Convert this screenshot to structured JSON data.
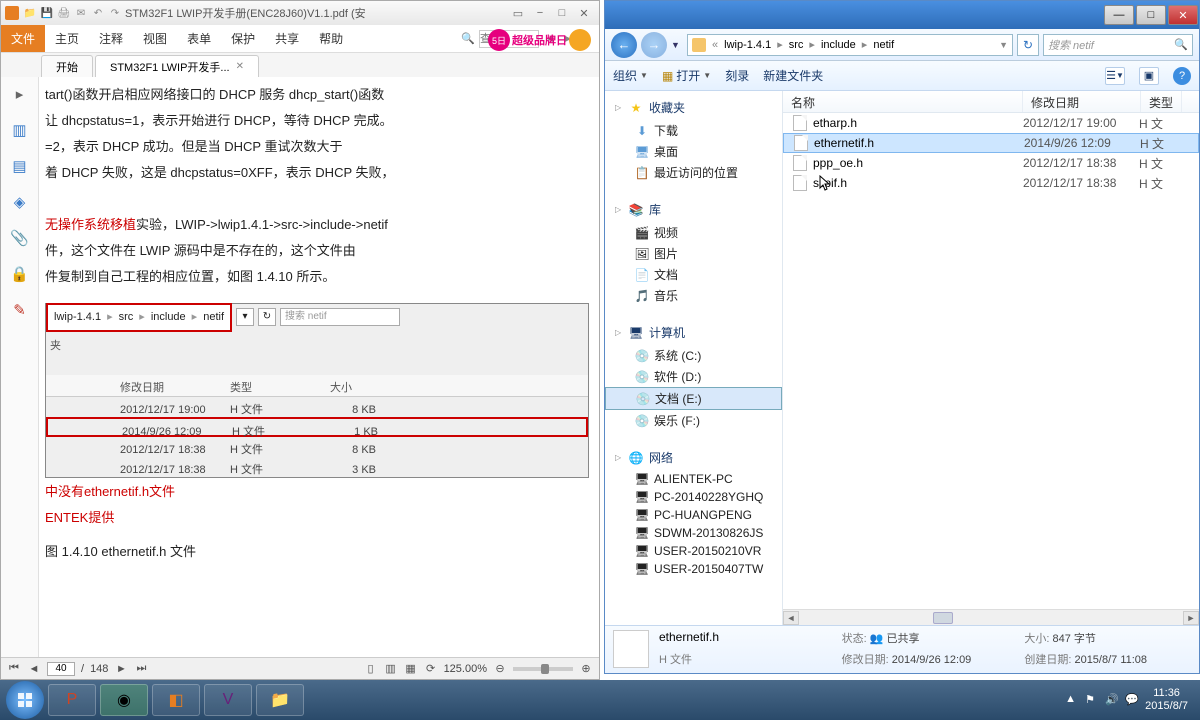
{
  "pdf": {
    "title": "STM32F1 LWIP开发手册(ENC28J60)V1.1.pdf (安",
    "menu": [
      "文件",
      "主页",
      "注释",
      "视图",
      "表单",
      "保护",
      "共享",
      "帮助"
    ],
    "search_placeholder": "查找",
    "promo": "超级品牌日",
    "promo_num": "5日",
    "tabs": [
      {
        "label": "开始"
      },
      {
        "label": "STM32F1 LWIP开发手..."
      }
    ],
    "body": {
      "p1": "tart()函数开启相应网络接口的 DHCP 服务 dhcp_start()函数",
      "p2": "让 dhcpstatus=1，表示开始进行 DHCP，等待 DHCP 完成。",
      "p3": "=2，表示 DHCP 成功。但是当 DHCP 重试次数大于",
      "p4": "着 DHCP 失败，这是 dhcpstatus=0XFF，表示 DHCP 失败，",
      "p5a": "无操作系统移植",
      "p5b": "实验，LWIP->lwip1.4.1->src->include->netif",
      "p6": "件，这个文件在 LWIP 源码中是不存在的，这个文件由",
      "p7": "件复制到自己工程的相应位置，如图 1.4.10 所示。",
      "crumb": [
        "lwip-1.4.1",
        "src",
        "include",
        "netif"
      ],
      "search2": "搜索 netif",
      "folder_label": "夹",
      "cols": [
        "修改日期",
        "类型",
        "大小"
      ],
      "rows": [
        {
          "d": "2012/12/17 19:00",
          "t": "H 文件",
          "s": "8 KB"
        },
        {
          "d": "2014/9/26 12:09",
          "t": "H 文件",
          "s": "1 KB"
        },
        {
          "d": "2012/12/17 18:38",
          "t": "H 文件",
          "s": "8 KB"
        },
        {
          "d": "2012/12/17 18:38",
          "t": "H 文件",
          "s": "3 KB"
        }
      ],
      "note1": "中没有ethernetif.h文件",
      "note2": "ENTEK提供",
      "caption": "图 1.4.10 ethernetif.h 文件"
    },
    "status": {
      "page": "40",
      "total": "148",
      "zoom": "125.00%"
    }
  },
  "explorer": {
    "crumbs": [
      "lwip-1.4.1",
      "src",
      "include",
      "netif"
    ],
    "search_placeholder": "搜索 netif",
    "toolbar": {
      "org": "组织",
      "open": "打开",
      "burn": "刻录",
      "newf": "新建文件夹"
    },
    "tree": {
      "fav": "收藏夹",
      "fav_items": [
        "下载",
        "桌面",
        "最近访问的位置"
      ],
      "lib": "库",
      "lib_items": [
        "视频",
        "图片",
        "文档",
        "音乐"
      ],
      "comp": "计算机",
      "comp_items": [
        "系统 (C:)",
        "软件 (D:)",
        "文档 (E:)",
        "娱乐 (F:)"
      ],
      "net": "网络",
      "net_items": [
        "ALIENTEK-PC",
        "PC-20140228YGHQ",
        "PC-HUANGPENG",
        "SDWM-20130826JS",
        "USER-20150210VR",
        "USER-20150407TW"
      ]
    },
    "cols": {
      "name": "名称",
      "date": "修改日期",
      "type": "类型"
    },
    "files": [
      {
        "n": "etharp.h",
        "d": "2012/12/17 19:00",
        "t": "H 文"
      },
      {
        "n": "ethernetif.h",
        "d": "2014/9/26 12:09",
        "t": "H 文"
      },
      {
        "n": "ppp_oe.h",
        "d": "2012/12/17 18:38",
        "t": "H 文"
      },
      {
        "n": "slipif.h",
        "d": "2012/12/17 18:38",
        "t": "H 文"
      }
    ],
    "details": {
      "name": "ethernetif.h",
      "type": "H 文件",
      "state_k": "状态:",
      "state_v": "已共享",
      "date_k": "修改日期:",
      "date_v": "2014/9/26 12:09",
      "size_k": "大小:",
      "size_v": "847 字节",
      "create_k": "创建日期:",
      "create_v": "2015/8/7 11:08"
    }
  },
  "taskbar": {
    "time": "11:36",
    "date": "2015/8/7"
  }
}
